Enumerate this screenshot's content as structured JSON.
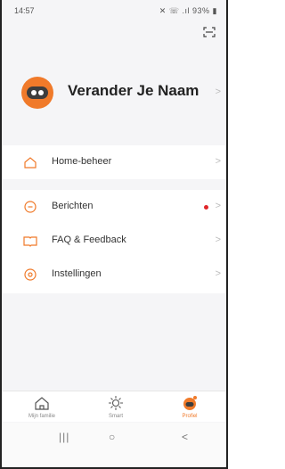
{
  "status": {
    "time": "14:57",
    "indicators": "✕ ☏ .ıl 93% ▮"
  },
  "header": {
    "scan_icon": "scan-icon"
  },
  "profile": {
    "name": "Verander Je Naam"
  },
  "menu": {
    "home": {
      "label": "Home-beheer",
      "icon": "home-icon"
    },
    "messages": {
      "label": "Berichten",
      "icon": "message-icon",
      "unread_dot_color": "#e0262a"
    },
    "faq": {
      "label": "FAQ & Feedback",
      "icon": "book-icon"
    },
    "settings": {
      "label": "Instellingen",
      "icon": "settings-icon"
    }
  },
  "tabs": [
    {
      "label": "Mijn familie",
      "icon": "home-icon",
      "active": false
    },
    {
      "label": "Smart",
      "icon": "sun-icon",
      "active": false
    },
    {
      "label": "Profiel",
      "icon": "profile-icon",
      "active": true
    }
  ],
  "colors": {
    "accent": "#f07a2a",
    "background": "#f5f5f7"
  }
}
